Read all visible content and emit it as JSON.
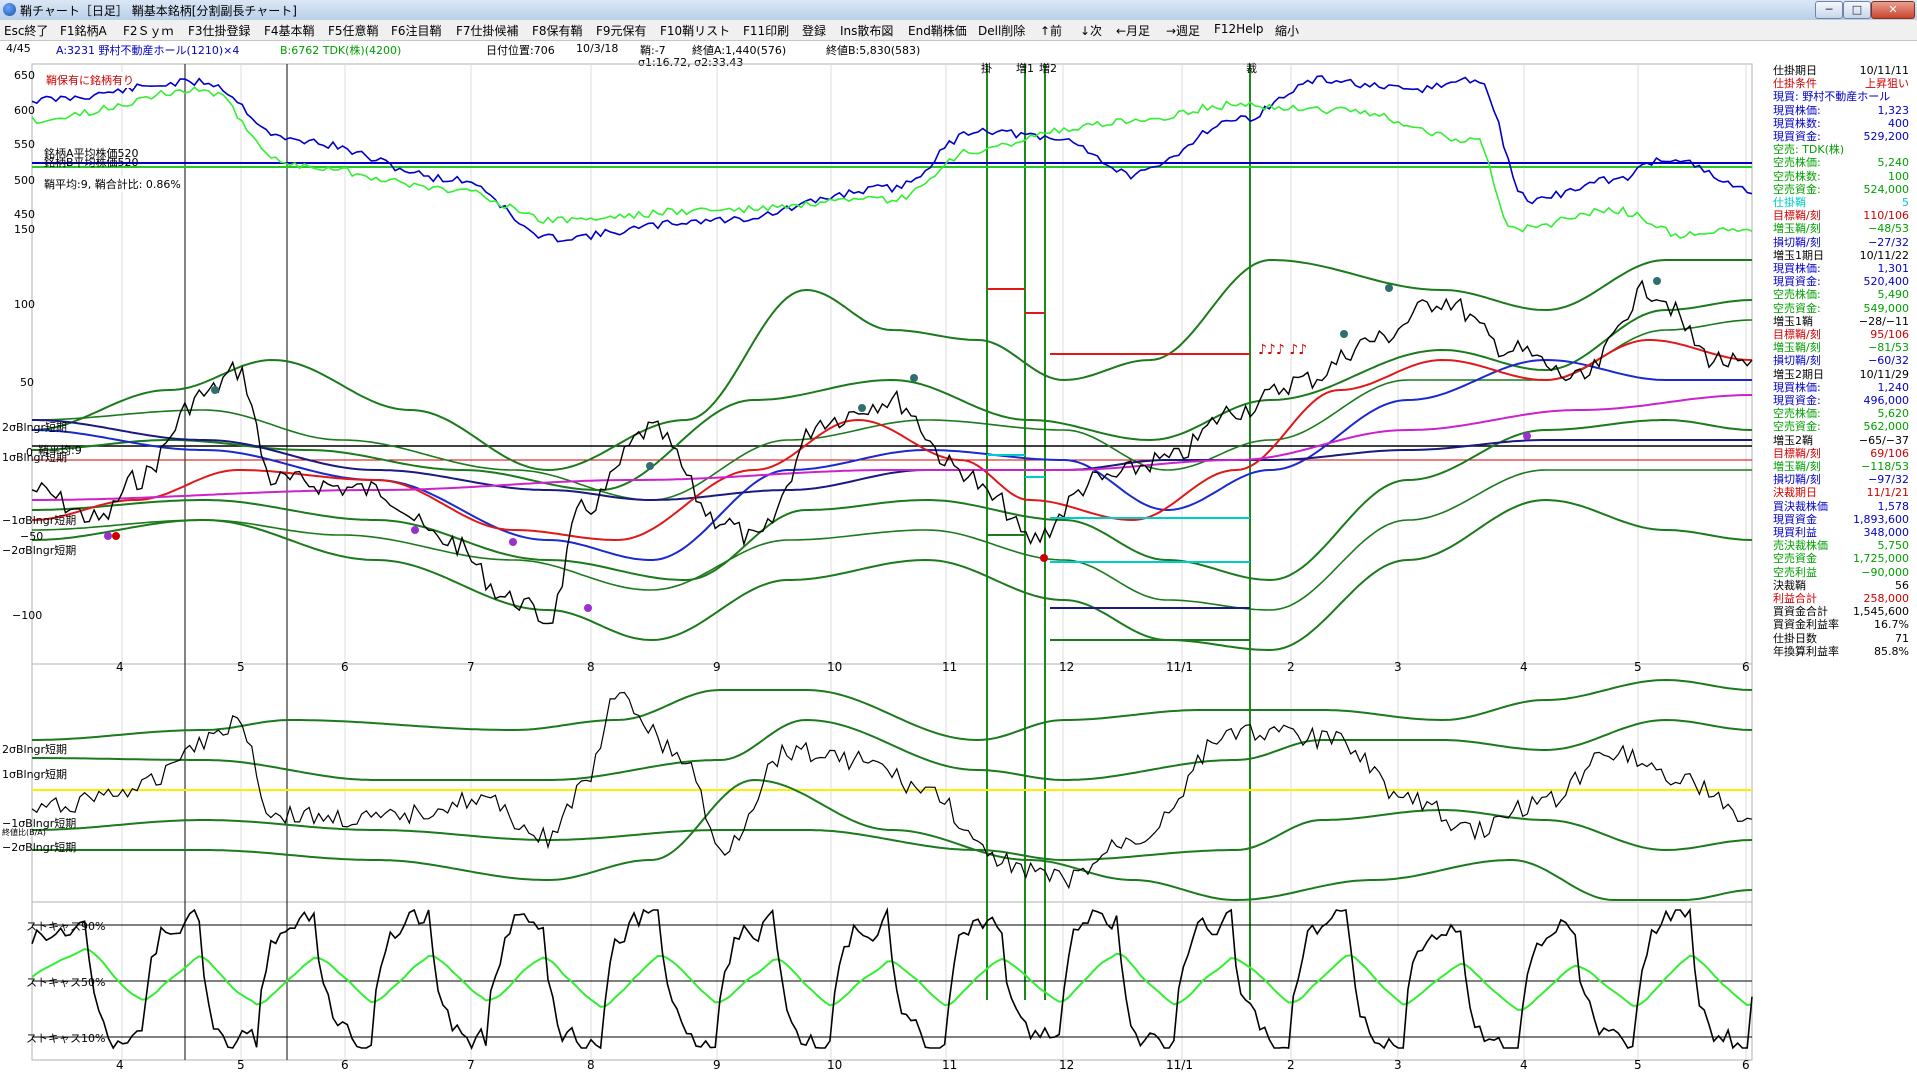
{
  "window": {
    "title": "鞘チャート［日足］ 鞘基本銘柄[分割副長チャート]",
    "minimize": "─",
    "maximize": "□",
    "close": "✕"
  },
  "menu": [
    "Esc終了",
    "F1銘柄A",
    "F2Ｓｙｍ",
    "F3仕掛登録",
    "F4基本鞘",
    "F5任意鞘",
    "F6注目鞘",
    "F7仕掛候補",
    "F8保有鞘",
    "F9元保有",
    "F10鞘リスト",
    "F11印刷",
    "登録",
    "Ins散布図",
    "End鞘株価",
    "Dell削除",
    "↑前",
    "↓次",
    "←月足",
    "→週足",
    "F12Help",
    "縮小"
  ],
  "info": {
    "page": "4/45",
    "stock_a": "A:3231 野村不動産ホール(1210)×4",
    "stock_b": "B:6762 TDK(株)(4200)",
    "date_pos": "日付位置:706",
    "date": "10/3/18",
    "spread": "鞘:-7",
    "close_a": "終値A:1,440(576)",
    "close_b": "終値B:5,830(583)",
    "sigma": "σ1:16.72, σ2:33.43"
  },
  "chart_notes": {
    "hold_note": "鞘保有に銘柄有り",
    "avg_a": "銘柄A平均株価520",
    "avg_b": "銘柄B平均株価520",
    "avg_ratio": "鞘平均:9, 鞘合計比: 0.86%",
    "spread_mid": "鞘平均:9",
    "bands_main": [
      "2σBlngr短期",
      "1σBlngr短期",
      "−1σBlngr短期",
      "−2σBlngr短期"
    ],
    "bands_mid": [
      "2σBlngr短期",
      "1σBlngr短期",
      "−1σBlngr短期",
      "−2σBlngr短期"
    ],
    "sub_note": "終値比(B/A)",
    "stoch": [
      "ストキャス90%",
      "ストキャス50%",
      "ストキャス10%"
    ],
    "markers": [
      "掛",
      "増1",
      "増2",
      "裁"
    ],
    "notes_sym": "♪♪♪ ♪♪"
  },
  "axis": {
    "top": [
      "650",
      "600",
      "550",
      "500",
      "450"
    ],
    "main": [
      "150",
      "100",
      "50",
      "0",
      "−50",
      "−100"
    ],
    "months": [
      "4",
      "5",
      "6",
      "7",
      "8",
      "9",
      "10",
      "11",
      "12",
      "11/1",
      "2",
      "3",
      "4",
      "5",
      "6"
    ]
  },
  "panel": [
    {
      "k": "仕掛期日",
      "v": "10/11/11",
      "c": "#000"
    },
    {
      "k": "仕掛条件",
      "v": "上昇狙い",
      "c": "#d00000"
    },
    {
      "k": "現買: 野村不動産ホール",
      "v": "",
      "c": "#0000c8"
    },
    {
      "k": "現買株価:",
      "v": "1,323",
      "c": "#0000c8"
    },
    {
      "k": "現買株数:",
      "v": "400",
      "c": "#0000c8"
    },
    {
      "k": "現買資金:",
      "v": "529,200",
      "c": "#0000c8"
    },
    {
      "k": "空売: TDK(株)",
      "v": "",
      "c": "#00a000"
    },
    {
      "k": "空売株価:",
      "v": "5,240",
      "c": "#00a000"
    },
    {
      "k": "空売株数:",
      "v": "100",
      "c": "#00a000"
    },
    {
      "k": "空売資金:",
      "v": "524,000",
      "c": "#00a000"
    },
    {
      "k": "仕掛鞘",
      "v": "5",
      "c": "#00c8c8"
    },
    {
      "k": "目標鞘/刻",
      "v": "110/106",
      "c": "#d00000"
    },
    {
      "k": "増玉鞘/刻",
      "v": "−48/53",
      "c": "#00a000"
    },
    {
      "k": "損切鞘/刻",
      "v": "−27/32",
      "c": "#0000c8"
    },
    {
      "k": "増玉1期日",
      "v": "10/11/22",
      "c": "#000"
    },
    {
      "k": "現買株価:",
      "v": "1,301",
      "c": "#0000c8"
    },
    {
      "k": "現買資金:",
      "v": "520,400",
      "c": "#0000c8"
    },
    {
      "k": "空売株価:",
      "v": "5,490",
      "c": "#00a000"
    },
    {
      "k": "空売資金:",
      "v": "549,000",
      "c": "#00a000"
    },
    {
      "k": "増玉1鞘",
      "v": "−28/−11",
      "c": "#000"
    },
    {
      "k": "目標鞘/刻",
      "v": "95/106",
      "c": "#d00000"
    },
    {
      "k": "増玉鞘/刻",
      "v": "−81/53",
      "c": "#00a000"
    },
    {
      "k": "損切鞘/刻",
      "v": "−60/32",
      "c": "#0000c8"
    },
    {
      "k": "増玉2期日",
      "v": "10/11/29",
      "c": "#000"
    },
    {
      "k": "現買株価:",
      "v": "1,240",
      "c": "#0000c8"
    },
    {
      "k": "現買資金:",
      "v": "496,000",
      "c": "#0000c8"
    },
    {
      "k": "空売株価:",
      "v": "5,620",
      "c": "#00a000"
    },
    {
      "k": "空売資金:",
      "v": "562,000",
      "c": "#00a000"
    },
    {
      "k": "増玉2鞘",
      "v": "−65/−37",
      "c": "#000"
    },
    {
      "k": "目標鞘/刻",
      "v": "69/106",
      "c": "#d00000"
    },
    {
      "k": "増玉鞘/刻",
      "v": "−118/53",
      "c": "#00a000"
    },
    {
      "k": "損切鞘/刻",
      "v": "−97/32",
      "c": "#0000c8"
    },
    {
      "k": "決裁期日",
      "v": "11/1/21",
      "c": "#d00000"
    },
    {
      "k": "買決裁株価",
      "v": "1,578",
      "c": "#0000c8"
    },
    {
      "k": "現買資金",
      "v": "1,893,600",
      "c": "#0000c8"
    },
    {
      "k": "現買利益",
      "v": "348,000",
      "c": "#0000c8"
    },
    {
      "k": "売決裁株価",
      "v": "5,750",
      "c": "#00a000"
    },
    {
      "k": "空売資金",
      "v": "1,725,000",
      "c": "#00a000"
    },
    {
      "k": "空売利益",
      "v": "−90,000",
      "c": "#00a000"
    },
    {
      "k": "決裁鞘",
      "v": "56",
      "c": "#000"
    },
    {
      "k": "利益合計",
      "v": "258,000",
      "c": "#d00000"
    },
    {
      "k": "買資金合計",
      "v": "1,545,600",
      "c": "#000"
    },
    {
      "k": "買資金利益率",
      "v": "16.7%",
      "c": "#000"
    },
    {
      "k": "仕掛日数",
      "v": "71",
      "c": "#000"
    },
    {
      "k": "年換算利益率",
      "v": "85.8%",
      "c": "#000"
    }
  ]
}
